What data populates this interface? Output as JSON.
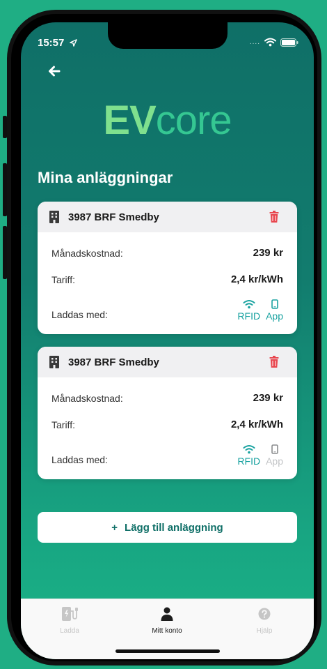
{
  "status": {
    "time": "15:57",
    "signal_dots": "...."
  },
  "logo": {
    "ev": "EV",
    "core": "core"
  },
  "page_title": "Mina anläggningar",
  "facilities": [
    {
      "name": "3987 BRF Smedby",
      "monthly_label": "Månadskostnad:",
      "monthly_value": "239 kr",
      "tariff_label": "Tariff:",
      "tariff_value": "2,4 kr/kWh",
      "charge_label": "Laddas med:",
      "methods": [
        {
          "label": "RFID",
          "enabled": true
        },
        {
          "label": "App",
          "enabled": true
        }
      ]
    },
    {
      "name": "3987 BRF Smedby",
      "monthly_label": "Månadskostnad:",
      "monthly_value": "239 kr",
      "tariff_label": "Tariff:",
      "tariff_value": "2,4 kr/kWh",
      "charge_label": "Laddas med:",
      "methods": [
        {
          "label": "RFID",
          "enabled": true
        },
        {
          "label": "App",
          "enabled": false
        }
      ]
    }
  ],
  "add_button": {
    "icon": "+",
    "label": "Lägg till anläggning"
  },
  "tabs": [
    {
      "label": "Ladda",
      "icon": "charger-icon",
      "active": false
    },
    {
      "label": "Mitt konto",
      "icon": "user-icon",
      "active": true
    },
    {
      "label": "Hjälp",
      "icon": "help-icon",
      "active": false
    }
  ],
  "colors": {
    "accent": "#18a2a0",
    "danger": "#e8474f",
    "logo_ev": "#7fe08e",
    "logo_core": "#35c792",
    "background_top": "#0f6f67",
    "background_bottom": "#1bb487"
  }
}
